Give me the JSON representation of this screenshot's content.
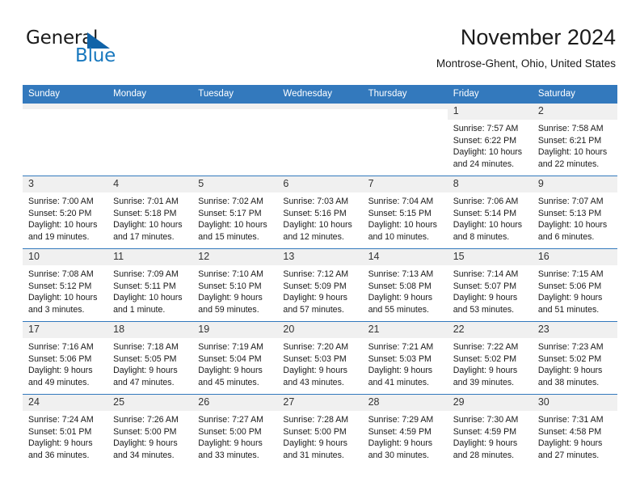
{
  "brand": {
    "name_part1": "General",
    "name_part2": "Blue",
    "triangle_color": "#1063a8",
    "blue_color": "#1878be"
  },
  "header": {
    "month_title": "November 2024",
    "location": "Montrose-Ghent, Ohio, United States",
    "header_bg": "#3379bd",
    "daynum_bg": "#f0f0f0"
  },
  "weekday_headers": [
    "Sunday",
    "Monday",
    "Tuesday",
    "Wednesday",
    "Thursday",
    "Friday",
    "Saturday"
  ],
  "labels": {
    "sunrise_prefix": "Sunrise:",
    "sunset_prefix": "Sunset:",
    "daylight_prefix": "Daylight:"
  },
  "weeks": [
    [
      {
        "day": "",
        "blank": true,
        "sunrise": "",
        "sunset": "",
        "daylight_line1": "",
        "daylight_line2": ""
      },
      {
        "day": "",
        "blank": true,
        "sunrise": "",
        "sunset": "",
        "daylight_line1": "",
        "daylight_line2": ""
      },
      {
        "day": "",
        "blank": true,
        "sunrise": "",
        "sunset": "",
        "daylight_line1": "",
        "daylight_line2": ""
      },
      {
        "day": "",
        "blank": true,
        "sunrise": "",
        "sunset": "",
        "daylight_line1": "",
        "daylight_line2": ""
      },
      {
        "day": "",
        "blank": true,
        "sunrise": "",
        "sunset": "",
        "daylight_line1": "",
        "daylight_line2": ""
      },
      {
        "day": "1",
        "blank": false,
        "sunrise": "Sunrise: 7:57 AM",
        "sunset": "Sunset: 6:22 PM",
        "daylight_line1": "Daylight: 10 hours",
        "daylight_line2": "and 24 minutes."
      },
      {
        "day": "2",
        "blank": false,
        "sunrise": "Sunrise: 7:58 AM",
        "sunset": "Sunset: 6:21 PM",
        "daylight_line1": "Daylight: 10 hours",
        "daylight_line2": "and 22 minutes."
      }
    ],
    [
      {
        "day": "3",
        "blank": false,
        "sunrise": "Sunrise: 7:00 AM",
        "sunset": "Sunset: 5:20 PM",
        "daylight_line1": "Daylight: 10 hours",
        "daylight_line2": "and 19 minutes."
      },
      {
        "day": "4",
        "blank": false,
        "sunrise": "Sunrise: 7:01 AM",
        "sunset": "Sunset: 5:18 PM",
        "daylight_line1": "Daylight: 10 hours",
        "daylight_line2": "and 17 minutes."
      },
      {
        "day": "5",
        "blank": false,
        "sunrise": "Sunrise: 7:02 AM",
        "sunset": "Sunset: 5:17 PM",
        "daylight_line1": "Daylight: 10 hours",
        "daylight_line2": "and 15 minutes."
      },
      {
        "day": "6",
        "blank": false,
        "sunrise": "Sunrise: 7:03 AM",
        "sunset": "Sunset: 5:16 PM",
        "daylight_line1": "Daylight: 10 hours",
        "daylight_line2": "and 12 minutes."
      },
      {
        "day": "7",
        "blank": false,
        "sunrise": "Sunrise: 7:04 AM",
        "sunset": "Sunset: 5:15 PM",
        "daylight_line1": "Daylight: 10 hours",
        "daylight_line2": "and 10 minutes."
      },
      {
        "day": "8",
        "blank": false,
        "sunrise": "Sunrise: 7:06 AM",
        "sunset": "Sunset: 5:14 PM",
        "daylight_line1": "Daylight: 10 hours",
        "daylight_line2": "and 8 minutes."
      },
      {
        "day": "9",
        "blank": false,
        "sunrise": "Sunrise: 7:07 AM",
        "sunset": "Sunset: 5:13 PM",
        "daylight_line1": "Daylight: 10 hours",
        "daylight_line2": "and 6 minutes."
      }
    ],
    [
      {
        "day": "10",
        "blank": false,
        "sunrise": "Sunrise: 7:08 AM",
        "sunset": "Sunset: 5:12 PM",
        "daylight_line1": "Daylight: 10 hours",
        "daylight_line2": "and 3 minutes."
      },
      {
        "day": "11",
        "blank": false,
        "sunrise": "Sunrise: 7:09 AM",
        "sunset": "Sunset: 5:11 PM",
        "daylight_line1": "Daylight: 10 hours",
        "daylight_line2": "and 1 minute."
      },
      {
        "day": "12",
        "blank": false,
        "sunrise": "Sunrise: 7:10 AM",
        "sunset": "Sunset: 5:10 PM",
        "daylight_line1": "Daylight: 9 hours",
        "daylight_line2": "and 59 minutes."
      },
      {
        "day": "13",
        "blank": false,
        "sunrise": "Sunrise: 7:12 AM",
        "sunset": "Sunset: 5:09 PM",
        "daylight_line1": "Daylight: 9 hours",
        "daylight_line2": "and 57 minutes."
      },
      {
        "day": "14",
        "blank": false,
        "sunrise": "Sunrise: 7:13 AM",
        "sunset": "Sunset: 5:08 PM",
        "daylight_line1": "Daylight: 9 hours",
        "daylight_line2": "and 55 minutes."
      },
      {
        "day": "15",
        "blank": false,
        "sunrise": "Sunrise: 7:14 AM",
        "sunset": "Sunset: 5:07 PM",
        "daylight_line1": "Daylight: 9 hours",
        "daylight_line2": "and 53 minutes."
      },
      {
        "day": "16",
        "blank": false,
        "sunrise": "Sunrise: 7:15 AM",
        "sunset": "Sunset: 5:06 PM",
        "daylight_line1": "Daylight: 9 hours",
        "daylight_line2": "and 51 minutes."
      }
    ],
    [
      {
        "day": "17",
        "blank": false,
        "sunrise": "Sunrise: 7:16 AM",
        "sunset": "Sunset: 5:06 PM",
        "daylight_line1": "Daylight: 9 hours",
        "daylight_line2": "and 49 minutes."
      },
      {
        "day": "18",
        "blank": false,
        "sunrise": "Sunrise: 7:18 AM",
        "sunset": "Sunset: 5:05 PM",
        "daylight_line1": "Daylight: 9 hours",
        "daylight_line2": "and 47 minutes."
      },
      {
        "day": "19",
        "blank": false,
        "sunrise": "Sunrise: 7:19 AM",
        "sunset": "Sunset: 5:04 PM",
        "daylight_line1": "Daylight: 9 hours",
        "daylight_line2": "and 45 minutes."
      },
      {
        "day": "20",
        "blank": false,
        "sunrise": "Sunrise: 7:20 AM",
        "sunset": "Sunset: 5:03 PM",
        "daylight_line1": "Daylight: 9 hours",
        "daylight_line2": "and 43 minutes."
      },
      {
        "day": "21",
        "blank": false,
        "sunrise": "Sunrise: 7:21 AM",
        "sunset": "Sunset: 5:03 PM",
        "daylight_line1": "Daylight: 9 hours",
        "daylight_line2": "and 41 minutes."
      },
      {
        "day": "22",
        "blank": false,
        "sunrise": "Sunrise: 7:22 AM",
        "sunset": "Sunset: 5:02 PM",
        "daylight_line1": "Daylight: 9 hours",
        "daylight_line2": "and 39 minutes."
      },
      {
        "day": "23",
        "blank": false,
        "sunrise": "Sunrise: 7:23 AM",
        "sunset": "Sunset: 5:02 PM",
        "daylight_line1": "Daylight: 9 hours",
        "daylight_line2": "and 38 minutes."
      }
    ],
    [
      {
        "day": "24",
        "blank": false,
        "sunrise": "Sunrise: 7:24 AM",
        "sunset": "Sunset: 5:01 PM",
        "daylight_line1": "Daylight: 9 hours",
        "daylight_line2": "and 36 minutes."
      },
      {
        "day": "25",
        "blank": false,
        "sunrise": "Sunrise: 7:26 AM",
        "sunset": "Sunset: 5:00 PM",
        "daylight_line1": "Daylight: 9 hours",
        "daylight_line2": "and 34 minutes."
      },
      {
        "day": "26",
        "blank": false,
        "sunrise": "Sunrise: 7:27 AM",
        "sunset": "Sunset: 5:00 PM",
        "daylight_line1": "Daylight: 9 hours",
        "daylight_line2": "and 33 minutes."
      },
      {
        "day": "27",
        "blank": false,
        "sunrise": "Sunrise: 7:28 AM",
        "sunset": "Sunset: 5:00 PM",
        "daylight_line1": "Daylight: 9 hours",
        "daylight_line2": "and 31 minutes."
      },
      {
        "day": "28",
        "blank": false,
        "sunrise": "Sunrise: 7:29 AM",
        "sunset": "Sunset: 4:59 PM",
        "daylight_line1": "Daylight: 9 hours",
        "daylight_line2": "and 30 minutes."
      },
      {
        "day": "29",
        "blank": false,
        "sunrise": "Sunrise: 7:30 AM",
        "sunset": "Sunset: 4:59 PM",
        "daylight_line1": "Daylight: 9 hours",
        "daylight_line2": "and 28 minutes."
      },
      {
        "day": "30",
        "blank": false,
        "sunrise": "Sunrise: 7:31 AM",
        "sunset": "Sunset: 4:58 PM",
        "daylight_line1": "Daylight: 9 hours",
        "daylight_line2": "and 27 minutes."
      }
    ]
  ]
}
